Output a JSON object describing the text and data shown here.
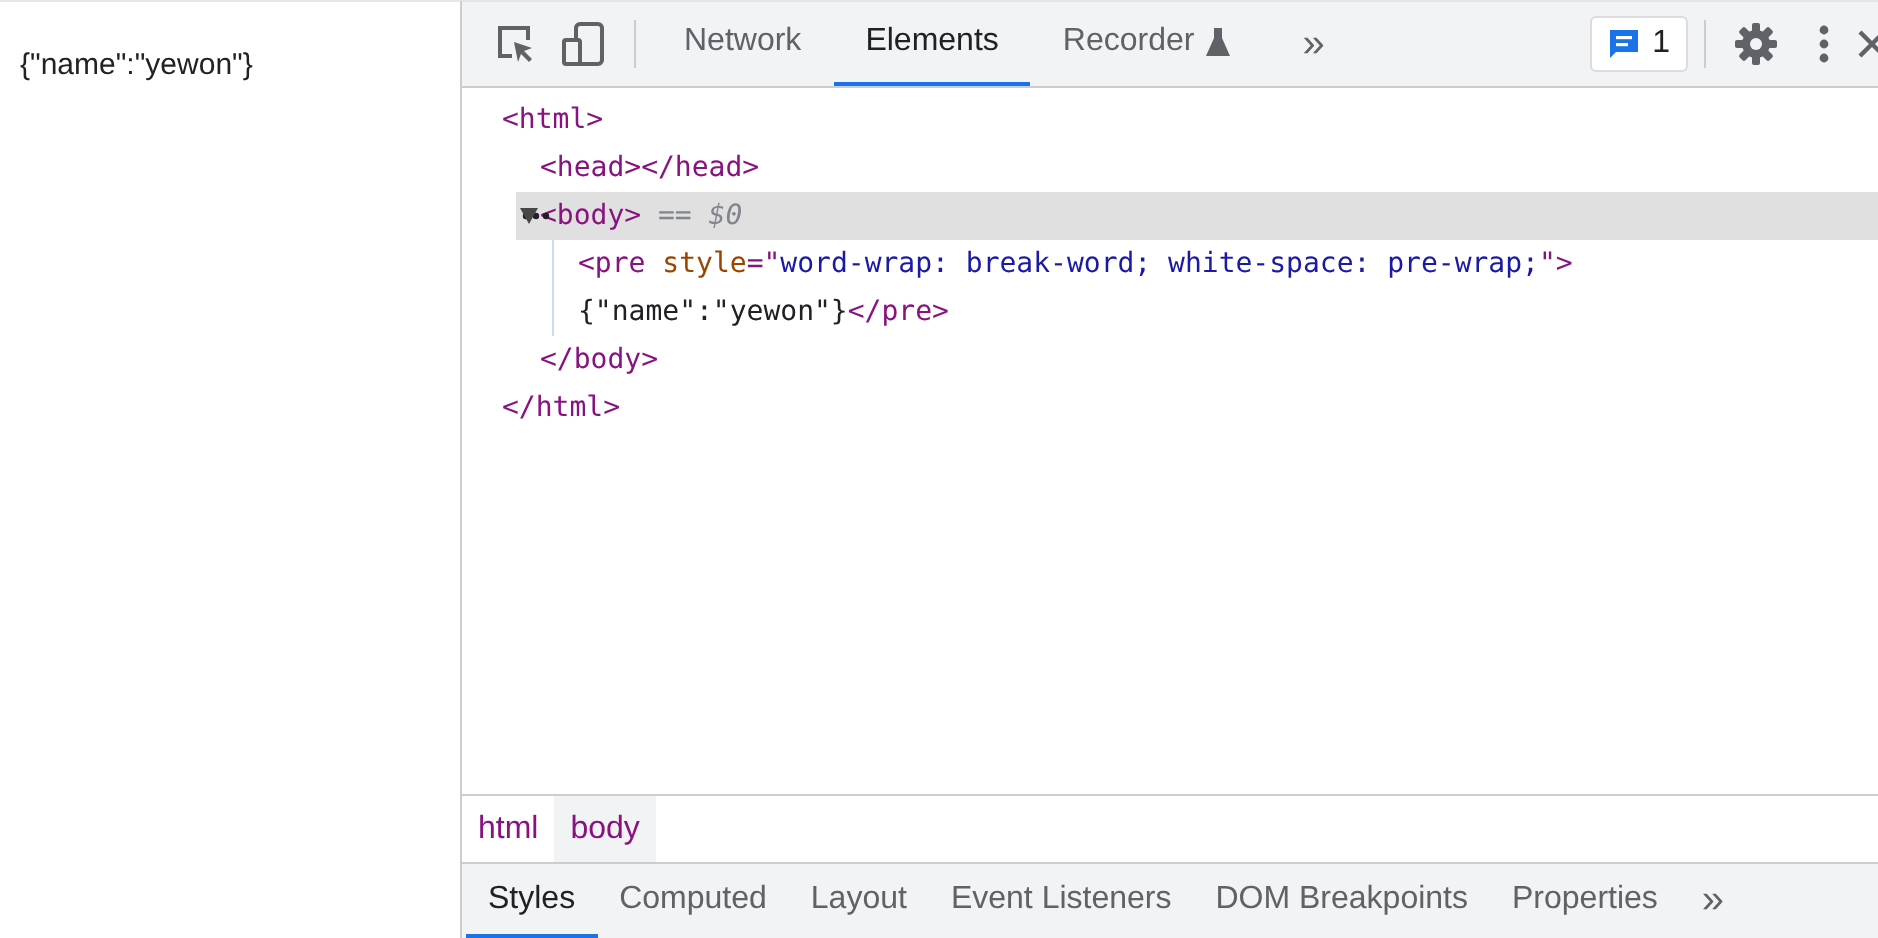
{
  "page": {
    "text": "{\"name\":\"yewon\"}"
  },
  "toolbar": {
    "tabs": [
      {
        "label": "Network",
        "selected": false
      },
      {
        "label": "Elements",
        "selected": true
      },
      {
        "label": "Recorder",
        "selected": false,
        "kind": "experimental"
      }
    ],
    "overflow": "»",
    "issues_count": "1"
  },
  "dom_tree": [
    {
      "lines": [
        [
          {
            "kind": "tag",
            "text": "<html>"
          }
        ]
      ],
      "selected": false,
      "children": [
        {
          "lines": [
            [
              {
                "kind": "tag",
                "text": "<head></head>"
              }
            ]
          ],
          "selected": false
        },
        {
          "lines": [
            [
              {
                "kind": "tag",
                "text": "<body>"
              },
              {
                "kind": "muted",
                "text": " == $0"
              }
            ]
          ],
          "expanded": true,
          "selected": true,
          "children": [
            {
              "lines": [
                [
                  {
                    "kind": "tag",
                    "text": "<pre "
                  },
                  {
                    "kind": "attr",
                    "text": "style"
                  },
                  {
                    "kind": "tag",
                    "text": "=\""
                  },
                  {
                    "kind": "value",
                    "text": "word-wrap: break-word; white-space: pre-wrap;"
                  },
                  {
                    "kind": "tag",
                    "text": "\">"
                  }
                ],
                [
                  {
                    "kind": "text",
                    "text": "{\"name\":\"yewon\"}"
                  },
                  {
                    "kind": "tag",
                    "text": "</pre>"
                  }
                ]
              ],
              "selected": false
            }
          ],
          "close": [
            {
              "kind": "tag",
              "text": "</body>"
            }
          ]
        }
      ],
      "close": [
        {
          "kind": "tag",
          "text": "</html>"
        }
      ]
    }
  ],
  "breadcrumbs": [
    {
      "label": "html",
      "selected": false
    },
    {
      "label": "body",
      "selected": true
    }
  ],
  "panel_tabs": {
    "tabs": [
      {
        "label": "Styles",
        "selected": true
      },
      {
        "label": "Computed",
        "selected": false
      },
      {
        "label": "Layout",
        "selected": false
      },
      {
        "label": "Event Listeners",
        "selected": false
      },
      {
        "label": "DOM Breakpoints",
        "selected": false
      },
      {
        "label": "Properties",
        "selected": false
      }
    ],
    "overflow": "»"
  }
}
